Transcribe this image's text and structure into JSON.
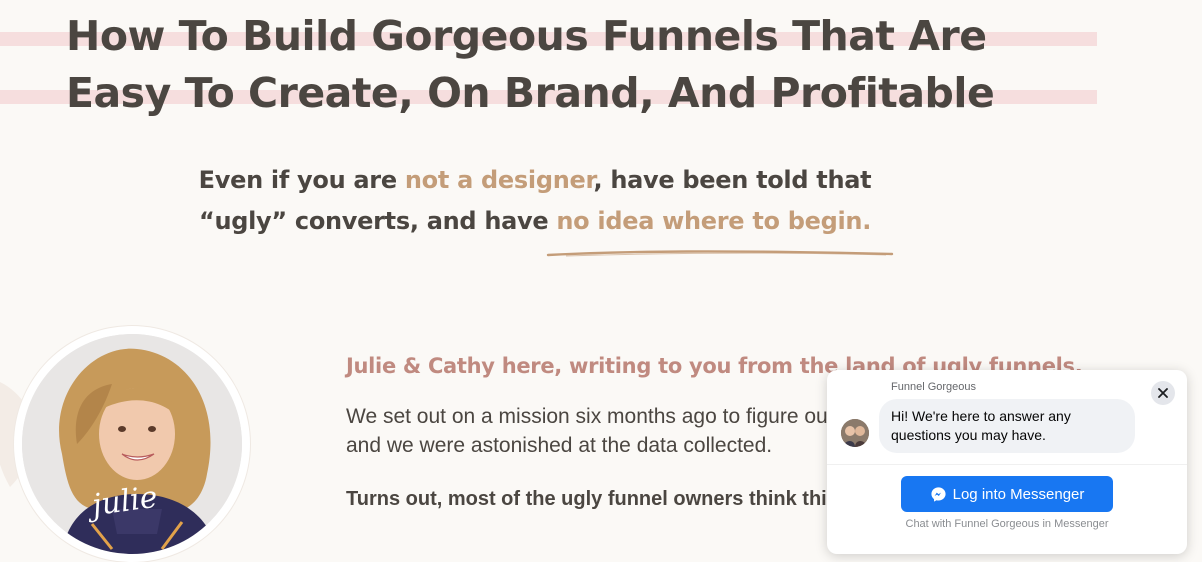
{
  "headline": {
    "line1": "How To Build Gorgeous Funnels That Are",
    "line2": "Easy To Create, On Brand, And Profitable"
  },
  "subhead": {
    "part1": "Even if you are ",
    "accent1": "not a designer",
    "part2": ", have been told that",
    "part3": "“ugly” converts, and have ",
    "accent2": "no idea where to begin."
  },
  "intro": {
    "title": "Julie & Cathy here, writing to you from the land of ugly funnels.",
    "body_line1": "We set out on a mission six months ago to figure out w",
    "body_line2": "and we were astonished at the data collected.",
    "bold_line": "Turns out, most of the ugly funnel owners think thi"
  },
  "avatar": {
    "signature": "julie"
  },
  "messenger": {
    "page_name": "Funnel Gorgeous",
    "greeting": "Hi! We're here to answer any questions you may have.",
    "login_label": "Log into Messenger",
    "footer": "Chat with Funnel Gorgeous in Messenger"
  },
  "colors": {
    "heading": "#4b4641",
    "accent_tan": "#c49d79",
    "accent_rose": "#c08a80",
    "stripe": "#f6dede",
    "messenger_blue": "#1877f2"
  }
}
